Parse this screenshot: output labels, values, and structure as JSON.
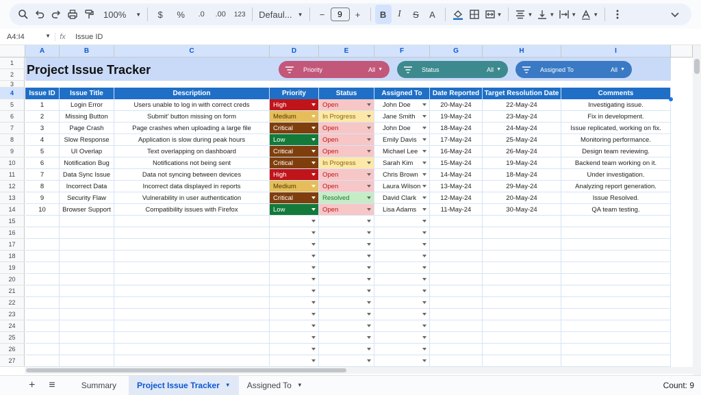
{
  "toolbar": {
    "zoom": "100%",
    "currency": "$",
    "percent": "%",
    "dec_decrease": ".0",
    "dec_increase": ".00",
    "number_format": "123",
    "font": "Defaul...",
    "minus": "−",
    "font_size": "9",
    "plus": "+",
    "bold": "B",
    "italic": "I",
    "strike": "S",
    "text_color": "A"
  },
  "formula_bar": {
    "cell_ref": "A4:I4",
    "fx": "fx",
    "content": "Issue ID"
  },
  "columns": [
    "A",
    "B",
    "C",
    "D",
    "E",
    "F",
    "G",
    "H",
    "I"
  ],
  "rows": [
    "1",
    "2",
    "3",
    "4",
    "5",
    "6",
    "7",
    "8",
    "9",
    "10",
    "11",
    "12",
    "13",
    "14",
    "15",
    "16",
    "17",
    "18",
    "19",
    "20",
    "21",
    "22",
    "23",
    "24",
    "25",
    "26",
    "27"
  ],
  "sheet_title": "Project Issue Tracker",
  "slicers": [
    {
      "label": "Priority",
      "value": "All",
      "color": "#c2577a"
    },
    {
      "label": "Status",
      "value": "All",
      "color": "#3d8a8e"
    },
    {
      "label": "Assigned To",
      "value": "All",
      "color": "#3a79c4"
    }
  ],
  "table": {
    "headers": [
      "Issue ID",
      "Issue Title",
      "Description",
      "Priority",
      "Status",
      "Assigned To",
      "Date Reported",
      "Target Resolution Date",
      "Comments"
    ],
    "rows": [
      [
        "1",
        "Login Error",
        "Users unable to log in with correct creds",
        "High",
        "Open",
        "John Doe",
        "20-May-24",
        "22-May-24",
        "Investigating issue."
      ],
      [
        "2",
        "Missing Button",
        "Submit' button missing on form",
        "Medium",
        "In Progress",
        "Jane Smith",
        "19-May-24",
        "23-May-24",
        "Fix in development."
      ],
      [
        "3",
        "Page Crash",
        "Page crashes when uploading a large file",
        "Critical",
        "Open",
        "John Doe",
        "18-May-24",
        "24-May-24",
        "Issue replicated, working on fix."
      ],
      [
        "4",
        "Slow Response",
        "Application is slow during peak hours",
        "Low",
        "Open",
        "Emily Davis",
        "17-May-24",
        "25-May-24",
        "Monitoring performance."
      ],
      [
        "5",
        "UI Overlap",
        "Text overlapping on dashboard",
        "Critical",
        "Open",
        "Michael Lee",
        "16-May-24",
        "26-May-24",
        "Design team reviewing."
      ],
      [
        "6",
        "Notification Bug",
        "Notifications not being sent",
        "Critical",
        "In Progress",
        "Sarah Kim",
        "15-May-24",
        "19-May-24",
        "Backend team working on it."
      ],
      [
        "7",
        "Data Sync Issue",
        "Data not syncing between devices",
        "High",
        "Open",
        "Chris Brown",
        "14-May-24",
        "18-May-24",
        "Under investigation."
      ],
      [
        "8",
        "Incorrect Data",
        "Incorrect data displayed in reports",
        "Medium",
        "Open",
        "Laura Wilson",
        "13-May-24",
        "29-May-24",
        "Analyzing report generation."
      ],
      [
        "9",
        "Security Flaw",
        "Vulnerability in user authentication",
        "Critical",
        "Resolved",
        "David Clark",
        "12-May-24",
        "20-May-24",
        "Issue Resolved."
      ],
      [
        "10",
        "Browser Support",
        "Compatibility issues with Firefox",
        "Low",
        "Open",
        "Lisa Adams",
        "11-May-24",
        "30-May-24",
        "QA team testing."
      ]
    ]
  },
  "colors": {
    "header_bg": "#1f6fc6",
    "priority": {
      "High": "#c0141b",
      "Medium": "#e6bd58",
      "Critical": "#7f3f0d",
      "Low": "#137a3a"
    },
    "priority_text": {
      "High": "#ffffff",
      "Medium": "#4a3a00",
      "Critical": "#ffffff",
      "Low": "#ffffff"
    },
    "status": {
      "Open": "#f7c6c6",
      "In Progress": "#fce8a8",
      "Resolved": "#c6ecc6"
    },
    "status_text": {
      "Open": "#c0141b",
      "In Progress": "#8a6a00",
      "Resolved": "#1e7a2e"
    }
  },
  "sheet_tabs": {
    "add": "+",
    "menu": "≡",
    "items": [
      "Summary",
      "Project Issue Tracker",
      "Assigned To"
    ],
    "active": "Project Issue Tracker"
  },
  "status_bar": {
    "count": "Count: 9"
  }
}
